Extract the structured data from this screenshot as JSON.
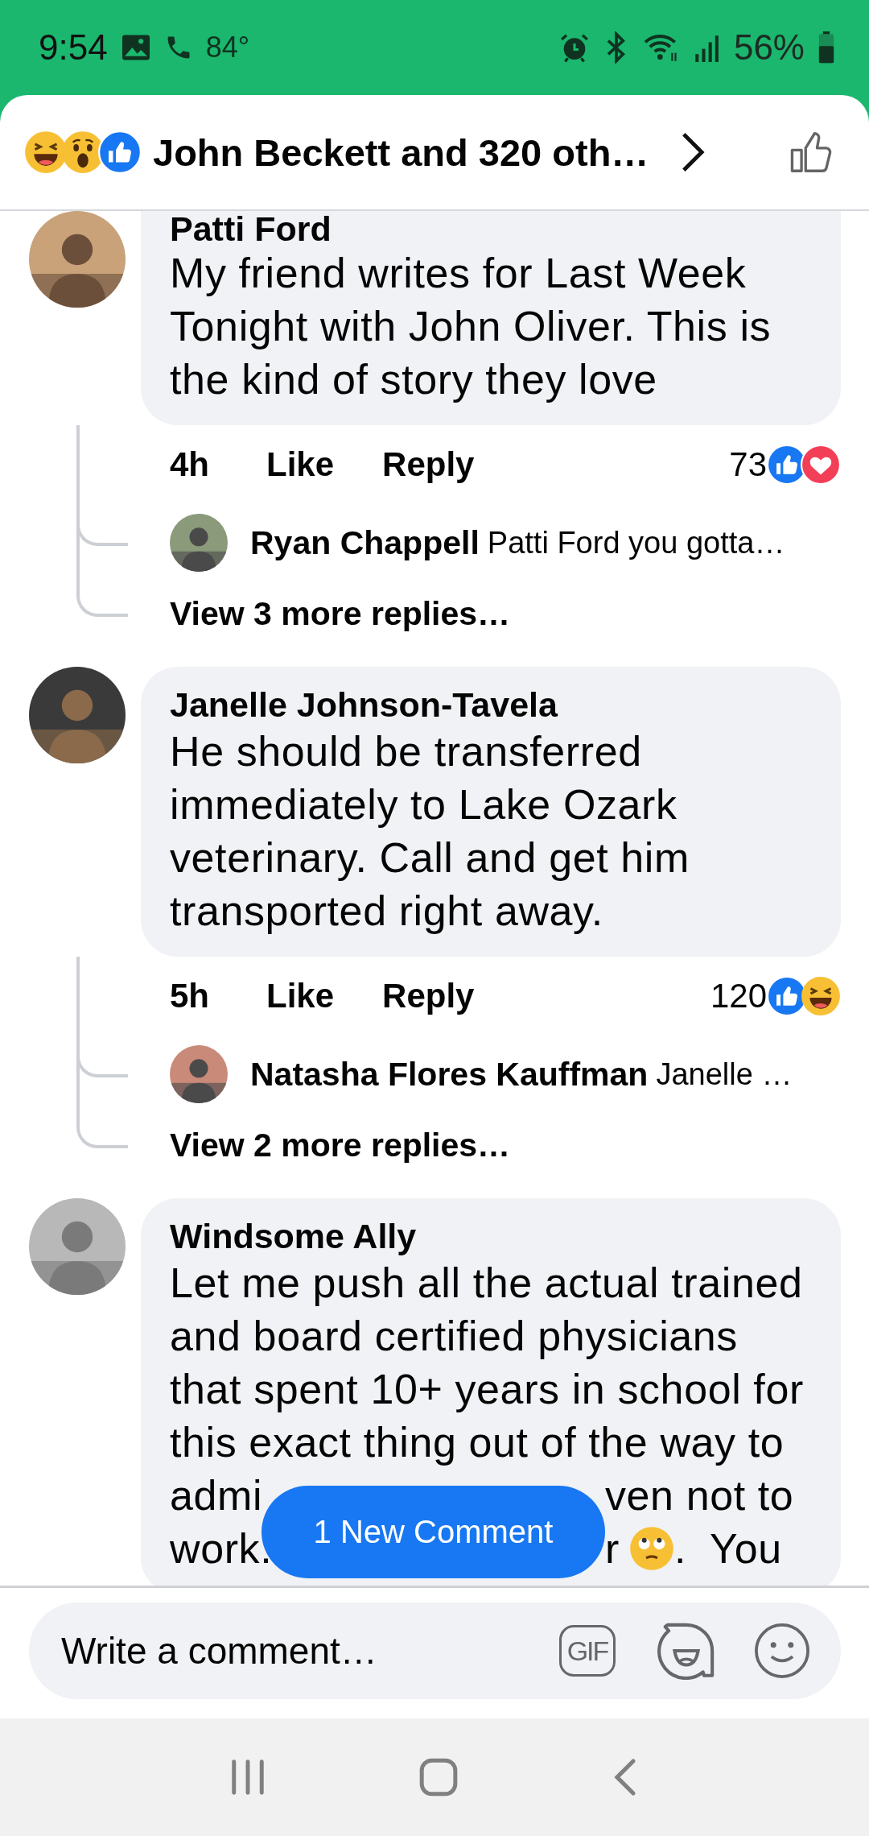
{
  "status_bar": {
    "time": "9:54",
    "temperature": "84°",
    "battery": "56%"
  },
  "header": {
    "reactions": [
      {
        "kind": "haha"
      },
      {
        "kind": "wow"
      },
      {
        "kind": "like"
      }
    ],
    "title": "John Beckett and 320 oth…"
  },
  "comments": [
    {
      "name": "Patti Ford",
      "text": "My friend writes for Last Week Tonight with John Oliver. This is the kind of story they love",
      "time": "4h",
      "like": "Like",
      "reply": "Reply",
      "count": "73",
      "reactions": [
        {
          "kind": "like"
        },
        {
          "kind": "love"
        }
      ],
      "reply_preview": {
        "name": "Ryan Chappell",
        "text": "Patti Ford you gotta…"
      },
      "more": "View 3 more replies…"
    },
    {
      "name": "Janelle Johnson-Tavela",
      "text": "He should be transferred immediately to Lake Ozark veterinary. Call and get him transported right away.",
      "time": "5h",
      "like": "Like",
      "reply": "Reply",
      "count": "120",
      "reactions": [
        {
          "kind": "like"
        },
        {
          "kind": "haha"
        }
      ],
      "reply_preview": {
        "name": "Natasha Flores Kauffman",
        "text": "Janelle …"
      },
      "more": "View 2 more replies…"
    },
    {
      "name": "Windsome Ally",
      "text": "Let me push all the actual trained and board certified physicians that spent 10+ years in school for this exact thing out of the way to",
      "covered_lines": [
        {
          "left": "admi",
          "right": "ven not to"
        },
        {
          "left": "work.",
          "parts": [
            {
              "kind": "text",
              "text": "r"
            },
            {
              "kind": "eye-roll"
            },
            {
              "kind": "text",
              "text": ".  You"
            }
          ]
        }
      ]
    }
  ],
  "new_comment_button": "1 New Comment",
  "composer": {
    "placeholder": "Write a comment…",
    "gif": "GIF"
  }
}
